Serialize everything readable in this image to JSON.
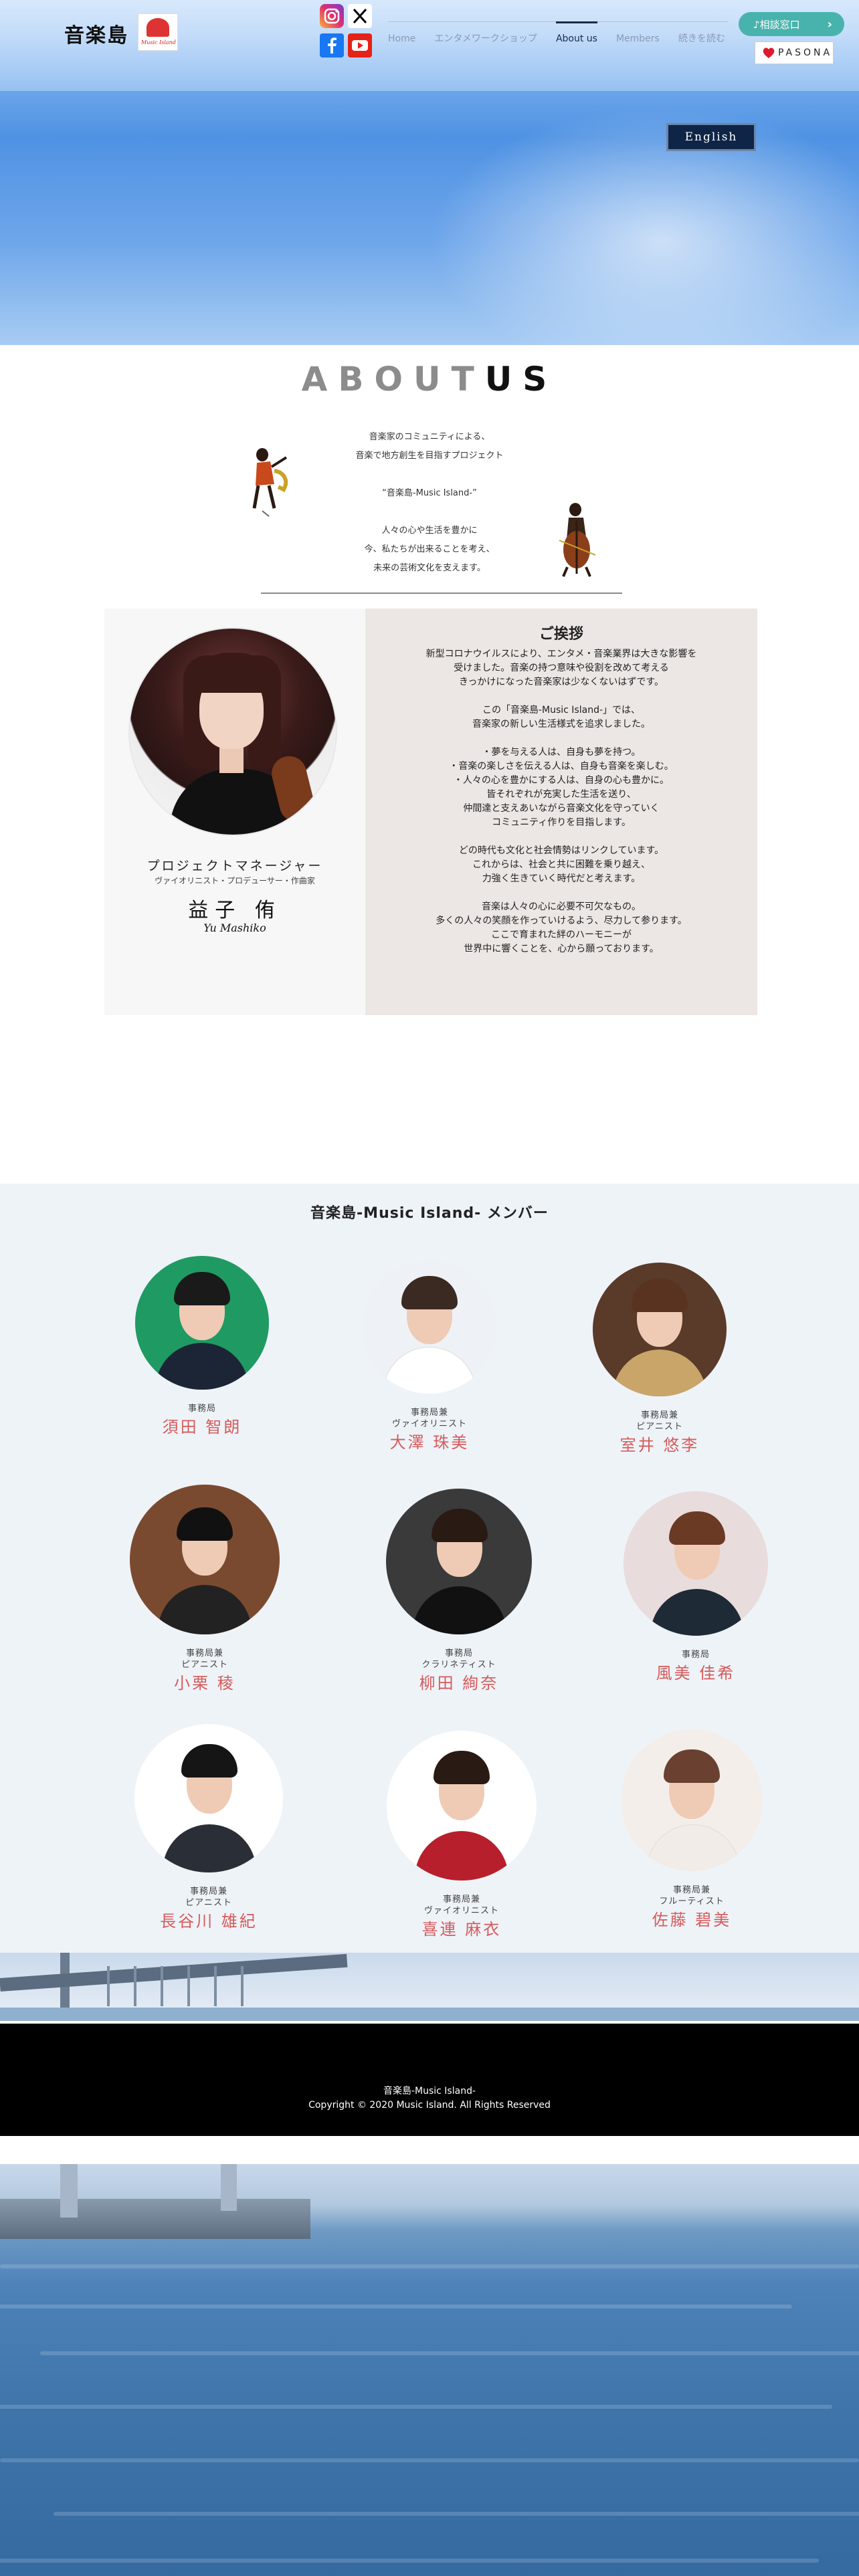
{
  "header": {
    "logo_text": "音楽島",
    "logo_badge_text": "Music Island",
    "nav": [
      "Home",
      "エンタメワークショップ",
      "About us",
      "Members",
      "続きを読む"
    ],
    "active_nav": "About us",
    "consult_button": "♪相談窓口",
    "pasona_label": "PASONA",
    "english_button": "English",
    "social": [
      "instagram-icon",
      "x-icon",
      "facebook-icon",
      "youtube-icon"
    ]
  },
  "about": {
    "title_light": "ABOUT",
    "title_dark": "US",
    "intro": [
      "音楽家のコミュニティによる、",
      "音楽で地方創生を目指すプロジェクト",
      "",
      "“音楽島-Music Island-”",
      "",
      "人々の心や生活を豊かに",
      "今、私たちが出来ることを考え、",
      "未来の芸術文化を支えます。"
    ]
  },
  "profile": {
    "role": "プロジェクトマネージャー",
    "subrole": "ヴァイオリニスト・プロデューサー・作曲家",
    "name": "益子 侑",
    "signature": "Yu Mashiko"
  },
  "greeting": {
    "title": "ご挨拶",
    "paragraphs": [
      "新型コロナウイルスにより、エンタメ・音楽業界は大きな影響を",
      "受けました。音楽の持つ意味や役割を改めて考える",
      "きっかけになった音楽家は少なくないはずです。",
      "",
      "この「音楽島-Music Island-」では、",
      "音楽家の新しい生活様式を追求しました。",
      "",
      "・夢を与える人は、自身も夢を持つ。",
      "・音楽の楽しさを伝える人は、自身も音楽を楽しむ。",
      "・人々の心を豊かにする人は、自身の心も豊かに。",
      "皆それぞれが充実した生活を送り、",
      "仲間達と支えあいながら音楽文化を守っていく",
      "コミュニティ作りを目指します。",
      "",
      "どの時代も文化と社会情勢はリンクしています。",
      "これからは、社会と共に困難を乗り越え、",
      "力強く生きていく時代だと考えます。",
      "",
      "音楽は人々の心に必要不可欠なもの。",
      "多くの人々の笑顔を作っていけるよう、尽力して参ります。",
      "ここで育まれた絆のハーモニーが",
      "世界中に響くことを、心から願っております。"
    ]
  },
  "members": {
    "title": "音楽島-Music Island- メンバー",
    "list": [
      {
        "role1": "事務局",
        "role2": "",
        "name": "須田 智朗"
      },
      {
        "role1": "事務局兼",
        "role2": "ヴァイオリニスト",
        "name": "大澤 珠美"
      },
      {
        "role1": "事務局兼",
        "role2": "ピアニスト",
        "name": "室井 悠李"
      },
      {
        "role1": "事務局兼",
        "role2": "ピアニスト",
        "name": "小栗 稜"
      },
      {
        "role1": "事務局",
        "role2": "クラリネティスト",
        "name": "柳田 絢奈"
      },
      {
        "role1": "事務局",
        "role2": "",
        "name": "風美 佳希"
      },
      {
        "role1": "事務局兼",
        "role2": "ピアニスト",
        "name": "長谷川 雄紀"
      },
      {
        "role1": "事務局兼",
        "role2": "ヴァイオリニスト",
        "name": "喜連 麻衣"
      },
      {
        "role1": "事務局兼",
        "role2": "フルーティスト",
        "name": "佐藤 碧美"
      }
    ]
  },
  "footer": {
    "line1": "音楽島-Music Island-",
    "line2": "Copyright © 2020 Music Island. All Rights Reserved"
  },
  "colors": {
    "accent_name": "#d65b5b",
    "consult_button": "#48b3ad",
    "english_button": "#0f2547",
    "greeting_bg": "#ece7e4",
    "members_bg": "#eef3f8"
  }
}
